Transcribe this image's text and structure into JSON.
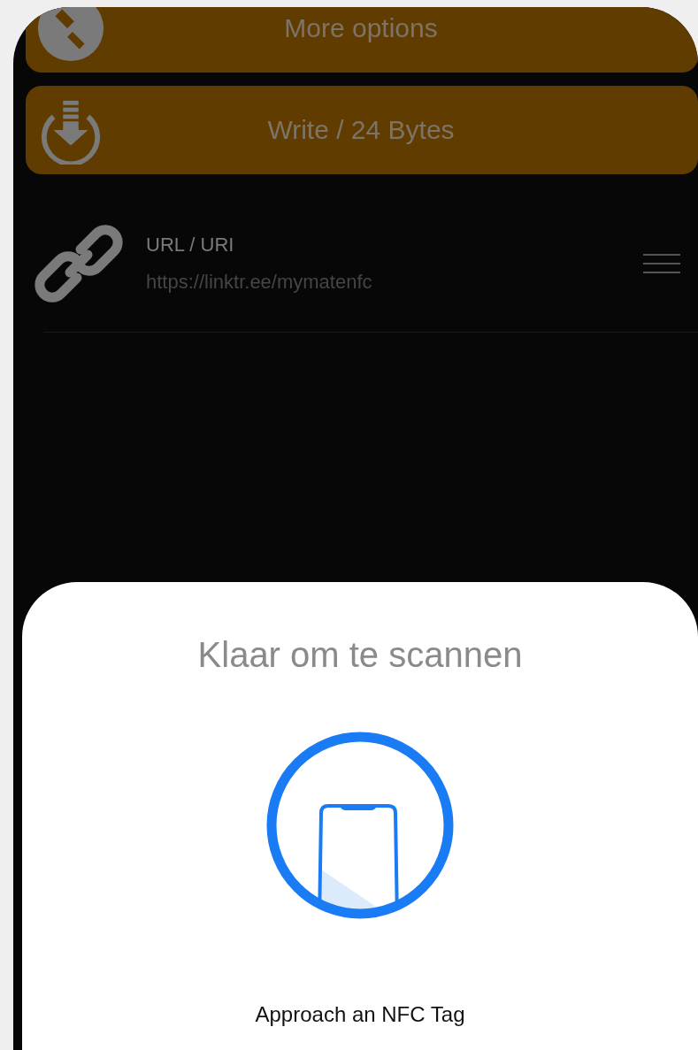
{
  "buttons": [
    {
      "label": "More options",
      "kind": "options"
    },
    {
      "label": "Write / 24 Bytes",
      "kind": "write"
    }
  ],
  "records": [
    {
      "title": "URL / URI",
      "value": "https://linktr.ee/mymatenfc"
    }
  ],
  "scan_sheet": {
    "title": "Klaar om te scannen",
    "message": "Approach an NFC Tag"
  }
}
